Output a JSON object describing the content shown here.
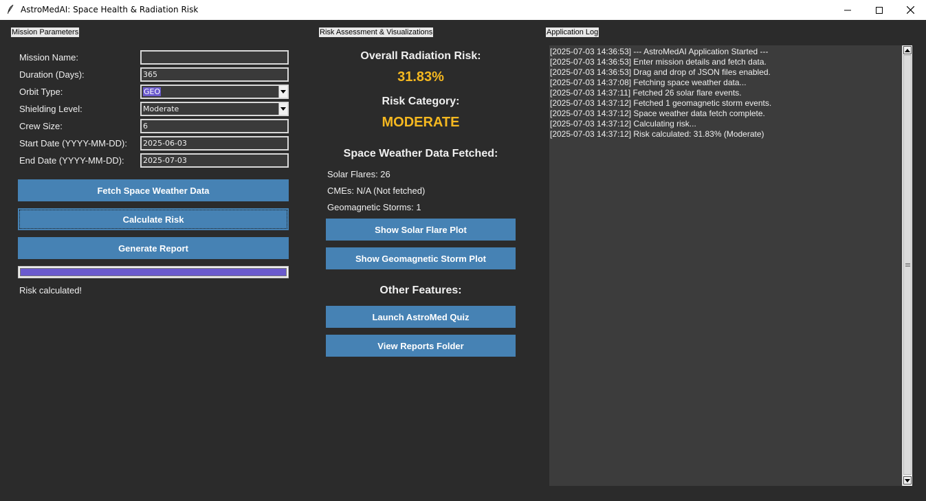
{
  "window": {
    "title": "AstroMedAI: Space Health & Radiation Risk"
  },
  "mission": {
    "section_label": "Mission Parameters",
    "fields": [
      {
        "label": "Mission Name:",
        "value": ""
      },
      {
        "label": "Duration (Days):",
        "value": "365"
      },
      {
        "label": "Orbit Type:",
        "value": "GEO"
      },
      {
        "label": "Shielding Level:",
        "value": "Moderate"
      },
      {
        "label": "Crew Size:",
        "value": "6"
      },
      {
        "label": "Start Date (YYYY-MM-DD):",
        "value": "2025-06-03"
      },
      {
        "label": "End Date (YYYY-MM-DD):",
        "value": "2025-07-03"
      }
    ],
    "buttons": {
      "fetch": "Fetch Space Weather Data",
      "calculate": "Calculate Risk",
      "report": "Generate Report"
    },
    "progress": 1.0,
    "status": "Risk calculated!"
  },
  "risk": {
    "section_label": "Risk Assessment & Visualizations",
    "overall_label": "Overall Radiation Risk:",
    "overall_value": "31.83%",
    "category_label": "Risk Category:",
    "category_value": "MODERATE",
    "weather_heading": "Space Weather Data Fetched:",
    "solar_flares": "Solar Flares: 26",
    "cmes": "CMEs: N/A (Not fetched)",
    "storms": "Geomagnetic Storms: 1",
    "buttons": {
      "solar_plot": "Show Solar Flare Plot",
      "storm_plot": "Show Geomagnetic Storm Plot",
      "quiz": "Launch AstroMed Quiz",
      "reports": "View Reports Folder"
    },
    "other_heading": "Other Features:",
    "accent_color": "#f5b820"
  },
  "log": {
    "section_label": "Application Log",
    "lines": [
      "[2025-07-03 14:36:53] --- AstroMedAI Application Started ---",
      "[2025-07-03 14:36:53] Enter mission details and fetch data.",
      "[2025-07-03 14:36:53] Drag and drop of JSON files enabled.",
      "[2025-07-03 14:37:08] Fetching space weather data...",
      "[2025-07-03 14:37:11] Fetched 26 solar flare events.",
      "[2025-07-03 14:37:12] Fetched 1 geomagnetic storm events.",
      "[2025-07-03 14:37:12] Space weather data fetch complete.",
      "[2025-07-03 14:37:12] Calculating risk...",
      "[2025-07-03 14:37:12] Risk calculated: 31.83% (Moderate)"
    ]
  }
}
